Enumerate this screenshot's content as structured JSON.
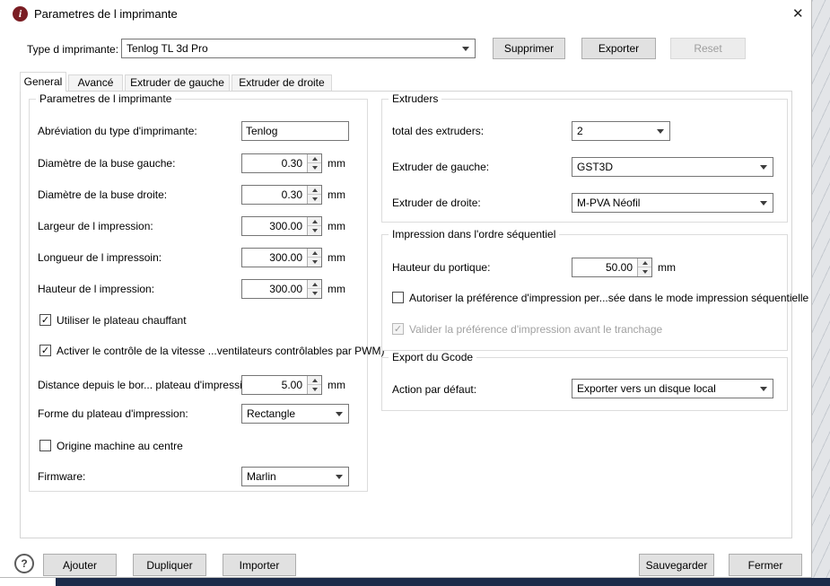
{
  "titlebar": {
    "icon": "i",
    "title": "Parametres de l imprimante",
    "close": "✕"
  },
  "header": {
    "type_label": "Type d imprimante:",
    "type_value": "Tenlog TL 3d Pro",
    "supprimer": "Supprimer",
    "exporter": "Exporter",
    "reset": "Reset"
  },
  "tabs": {
    "general": "General",
    "avance": "Avancé",
    "extruder_gauche": "Extruder de gauche",
    "extruder_droite": "Extruder de droite"
  },
  "printer_group": {
    "title": "Parametres de l imprimante",
    "abbreviation_label": "Abréviation du type d'imprimante:",
    "abbreviation_value": "Tenlog",
    "nozzle_left_label": "Diamètre de la buse gauche:",
    "nozzle_left_value": "0.30",
    "nozzle_right_label": "Diamètre de la buse droite:",
    "nozzle_right_value": "0.30",
    "width_label": "Largeur de l impression:",
    "width_value": "300.00",
    "depth_label": "Longueur de l impressoin:",
    "depth_value": "300.00",
    "height_label": "Hauteur de l impression:",
    "height_value": "300.00",
    "heated_bed_label": "Utiliser le plateau chauffant",
    "fan_pwm_label": "Activer le contrôle de la vitesse ...ventilateurs contrôlables par PWM)",
    "edge_distance_label": "Distance depuis le bor... plateau d'impression:",
    "edge_distance_value": "5.00",
    "bed_shape_label": "Forme du plateau d'impression:",
    "bed_shape_value": "Rectangle",
    "origin_center_label": "Origine machine au centre",
    "firmware_label": "Firmware:",
    "firmware_value": "Marlin",
    "mm": "mm"
  },
  "extruders_group": {
    "title": "Extruders",
    "total_label": "total des extruders:",
    "total_value": "2",
    "left_label": "Extruder de gauche:",
    "left_value": "GST3D",
    "right_label": "Extruder de droite:",
    "right_value": "M-PVA Néofil"
  },
  "sequential_group": {
    "title": "Impression dans l'ordre séquentiel",
    "gantry_label": "Hauteur du portique:",
    "gantry_value": "50.00",
    "mm": "mm",
    "allow_label": "Autoriser la préférence d'impression per...sée dans le mode impression séquentielle",
    "validate_label": "Valider la préférence d'impression avant le tranchage"
  },
  "gcode_group": {
    "title": "Export du Gcode",
    "action_label": "Action par défaut:",
    "action_value": "Exporter vers un disque local"
  },
  "footer": {
    "help": "?",
    "ajouter": "Ajouter",
    "dupliquer": "Dupliquer",
    "importer": "Importer",
    "sauvegarder": "Sauvegarder",
    "fermer": "Fermer"
  },
  "glyphs": {
    "check": "✓"
  }
}
